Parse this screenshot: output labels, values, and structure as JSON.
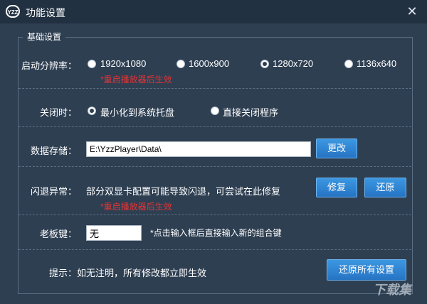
{
  "window": {
    "logo_text": "YZZ",
    "title": "功能设置",
    "close_glyph": "✕"
  },
  "section": {
    "legend": "基础设置"
  },
  "resolution": {
    "label": "启动分辨率：",
    "options": [
      "1920x1080",
      "1600x900",
      "1280x720",
      "1136x640"
    ],
    "selected": "1280x720",
    "note": "*重启播放器后生效"
  },
  "on_close": {
    "label": "关闭时：",
    "options": [
      "最小化到系统托盘",
      "直接关闭程序"
    ],
    "selected": "最小化到系统托盘"
  },
  "storage": {
    "label": "数据存储：",
    "path": "E:\\YzzPlayer\\Data\\",
    "change_button": "更改"
  },
  "crash": {
    "label": "闪退异常：",
    "description": "部分双显卡配置可能导致闪退，可尝试在此修复",
    "repair_button": "修复",
    "restore_button": "还原",
    "note": "*重启播放器后生效"
  },
  "boss_key": {
    "label": "老板键：",
    "value": "无",
    "hint": "*点击输入框后直接输入新的组合键"
  },
  "footer": {
    "tip": "提示：如无注明，所有修改都立即生效",
    "restore_all_button": "还原所有设置"
  },
  "watermark": "下载集"
}
